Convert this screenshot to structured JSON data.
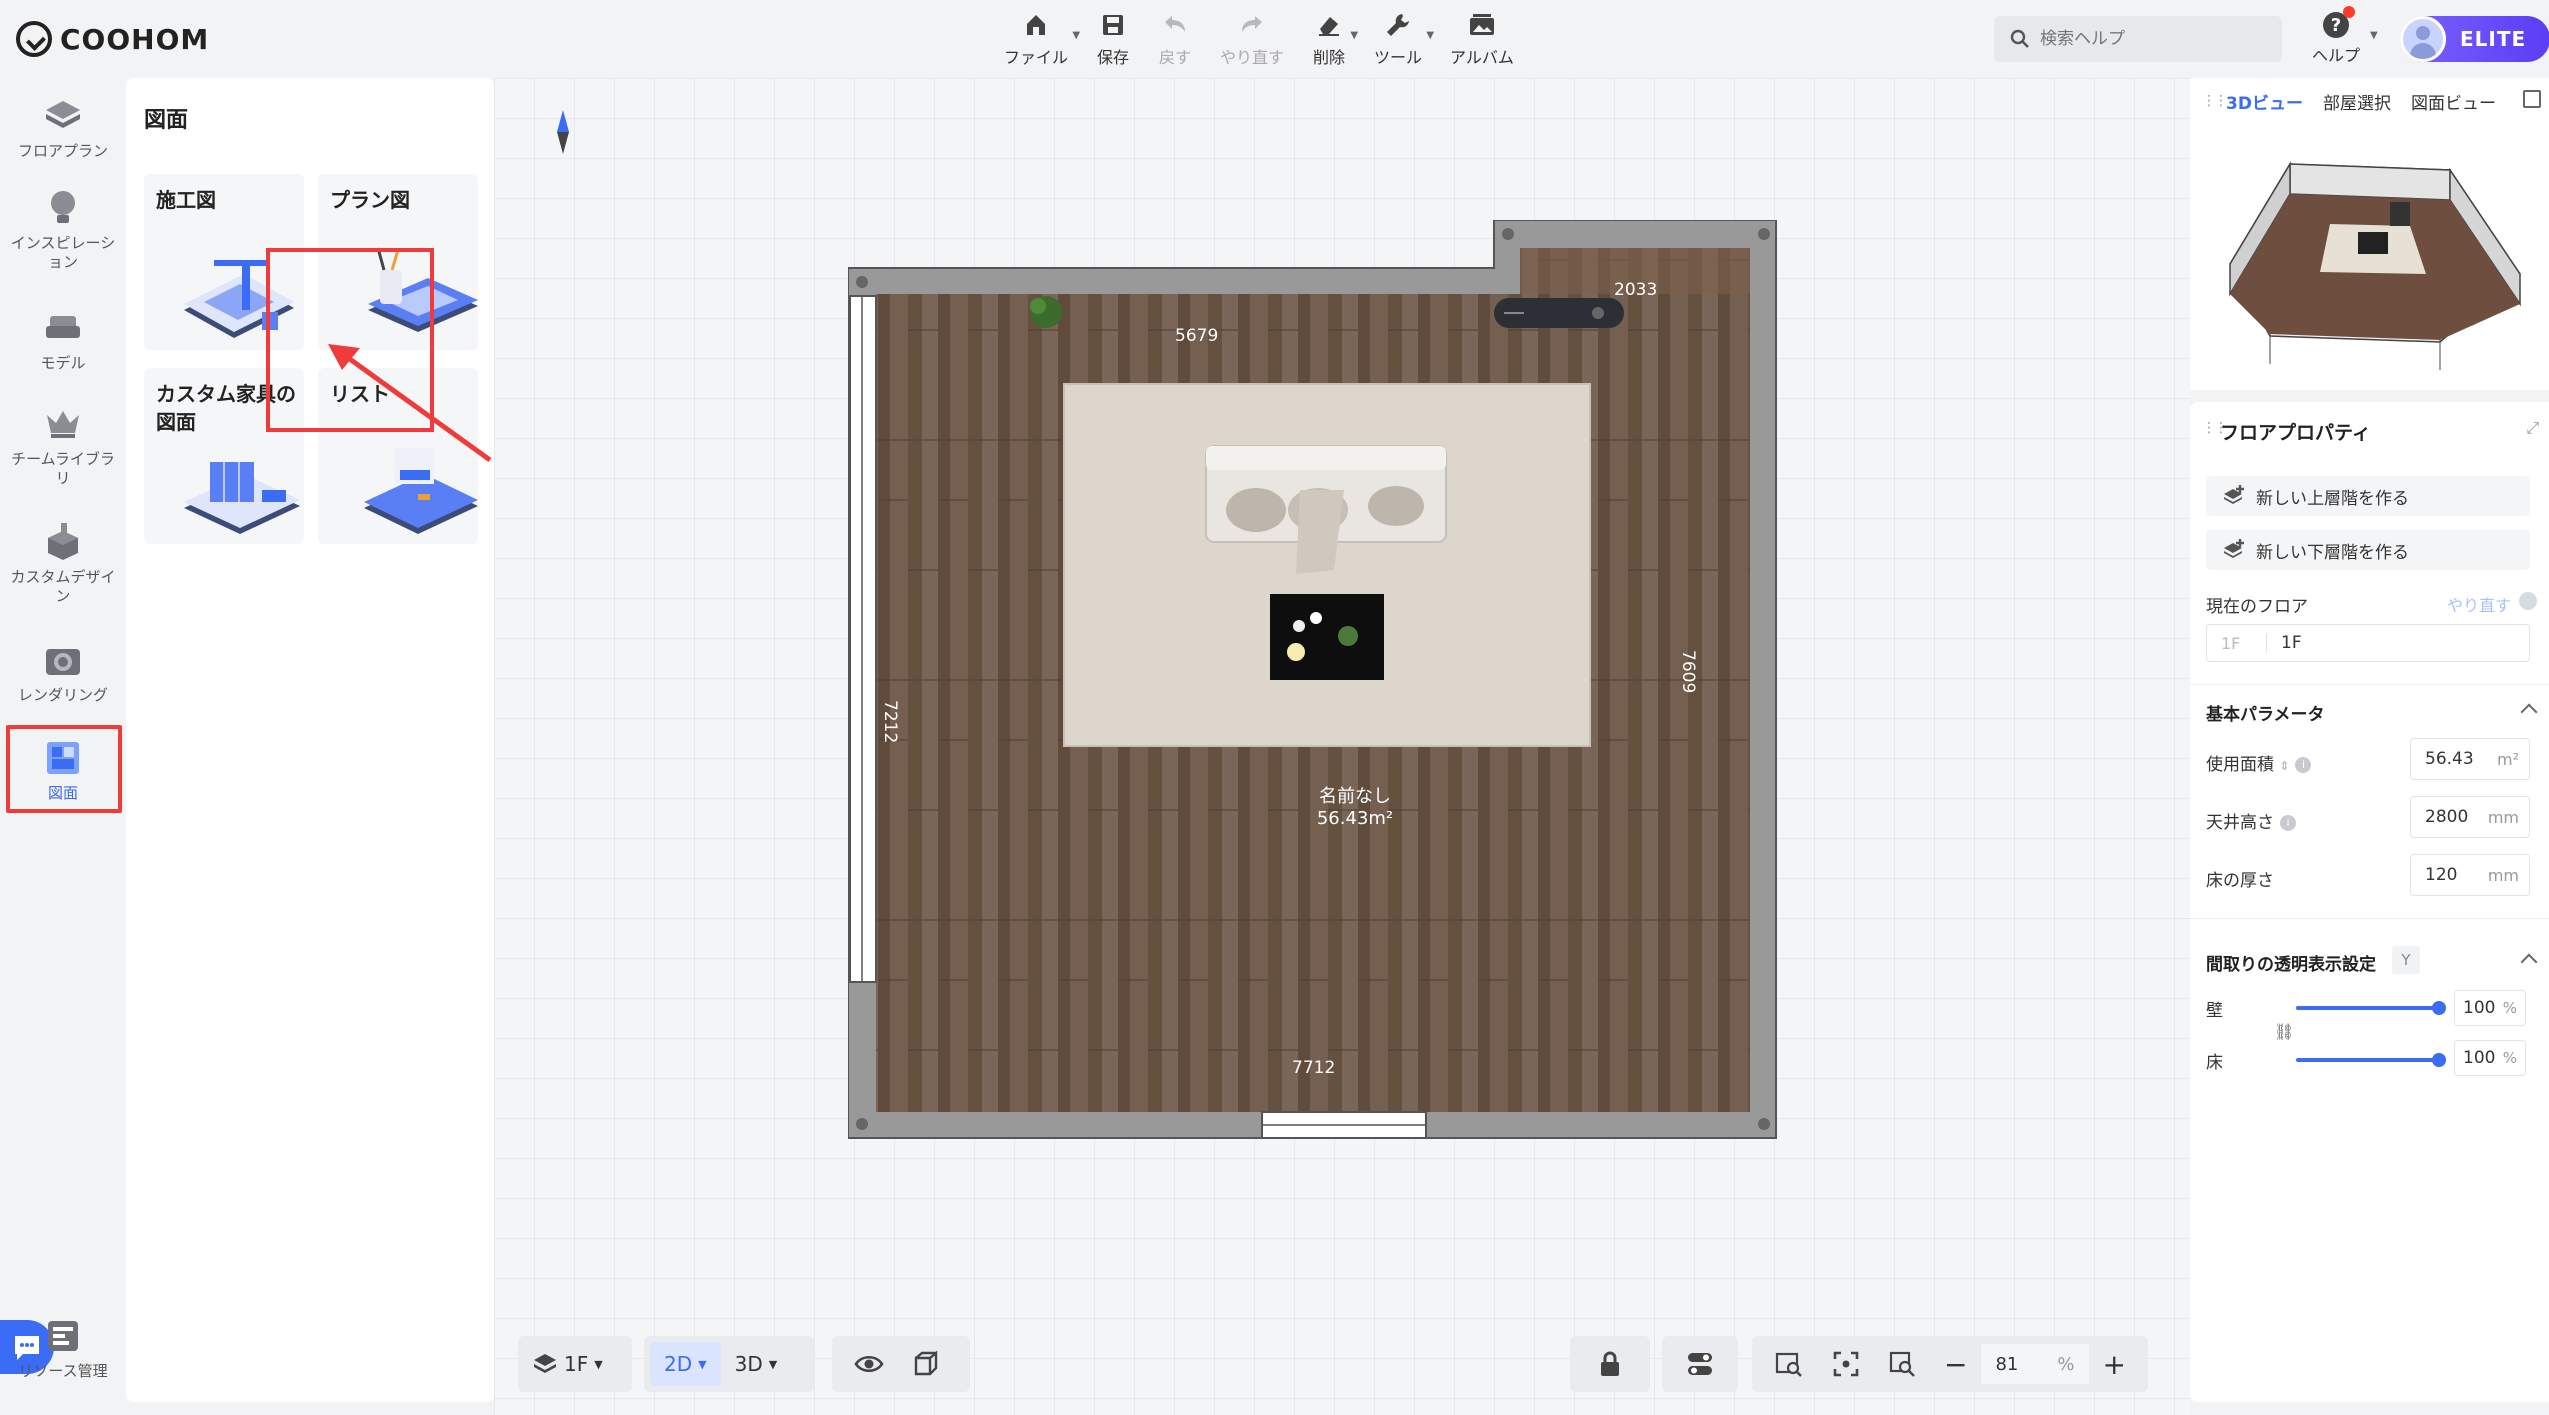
{
  "app": {
    "logo_text": "COOHOM"
  },
  "toolbar": {
    "file": "ファイル",
    "save": "保存",
    "undo": "戻す",
    "redo": "やり直す",
    "delete": "削除",
    "tools": "ツール",
    "album": "アルバム"
  },
  "search": {
    "placeholder": "検索ヘルプ"
  },
  "help": {
    "label": "ヘルプ"
  },
  "user": {
    "badge": "ELITE"
  },
  "nav": {
    "floorplan": "フロアプラン",
    "inspiration": "インスピレーション",
    "model": "モデル",
    "team_library": "チームライブラリ",
    "custom_design": "カスタムデザイン",
    "rendering": "レンダリング",
    "drawings": "図面",
    "resources": "リソース管理"
  },
  "panel": {
    "title": "図面",
    "cards": [
      "施工図",
      "プラン図",
      "カスタム家具の図面",
      "リスト"
    ]
  },
  "plan": {
    "dims": {
      "top": "5679",
      "corner": "2033",
      "left": "7212",
      "right": "7609",
      "bottom": "7712"
    },
    "room_name": "名前なし",
    "room_area": "56.43m²"
  },
  "bottom": {
    "floor": "1F",
    "view2d": "2D",
    "view3d": "3D",
    "zoom": "81",
    "zoom_unit": "%"
  },
  "view": {
    "tabs": [
      "3Dビュー",
      "部屋選択",
      "図面ビュー"
    ]
  },
  "props": {
    "title": "フロアプロパティ",
    "new_upper": "新しい上層階を作る",
    "new_lower": "新しい下層階を作る",
    "current_floor_label": "現在のフロア",
    "redo_link": "やり直す",
    "floor_prefix": "1F",
    "floor_value": "1F",
    "basic_params": "基本パラメータ",
    "area_label": "使用面積",
    "area_value": "56.43",
    "area_unit": "m²",
    "ceiling_label": "天井高さ",
    "ceiling_value": "2800",
    "ceiling_unit": "mm",
    "floor_thick_label": "床の厚さ",
    "floor_thick_value": "120",
    "floor_thick_unit": "mm",
    "transparency_title": "間取りの透明表示設定",
    "transparency_key": "Y",
    "wall_label": "壁",
    "wall_value": "100",
    "floor_label": "床",
    "floor_trans_value": "100",
    "pct": "%"
  }
}
